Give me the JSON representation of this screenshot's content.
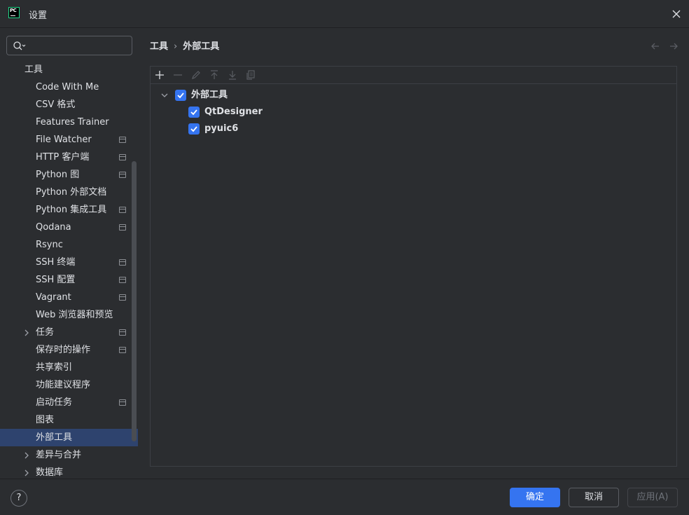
{
  "window": {
    "title": "设置"
  },
  "search": {
    "placeholder": ""
  },
  "sidebar": {
    "items": [
      {
        "label": "工具",
        "level": 0,
        "project": false
      },
      {
        "label": "Code With Me",
        "level": 1,
        "project": false
      },
      {
        "label": "CSV 格式",
        "level": 1,
        "project": false
      },
      {
        "label": "Features Trainer",
        "level": 1,
        "project": false
      },
      {
        "label": "File Watcher",
        "level": 1,
        "project": true
      },
      {
        "label": "HTTP 客户端",
        "level": 1,
        "project": true
      },
      {
        "label": "Python 图",
        "level": 1,
        "project": true
      },
      {
        "label": "Python 外部文档",
        "level": 1,
        "project": false
      },
      {
        "label": "Python 集成工具",
        "level": 1,
        "project": true
      },
      {
        "label": "Qodana",
        "level": 1,
        "project": true
      },
      {
        "label": "Rsync",
        "level": 1,
        "project": false
      },
      {
        "label": "SSH 终端",
        "level": 1,
        "project": true
      },
      {
        "label": "SSH 配置",
        "level": 1,
        "project": true
      },
      {
        "label": "Vagrant",
        "level": 1,
        "project": true
      },
      {
        "label": "Web 浏览器和预览",
        "level": 1,
        "project": false
      },
      {
        "label": "任务",
        "level": 1,
        "project": true,
        "expandable": true
      },
      {
        "label": "保存时的操作",
        "level": 1,
        "project": true
      },
      {
        "label": "共享索引",
        "level": 1,
        "project": false
      },
      {
        "label": "功能建议程序",
        "level": 1,
        "project": false
      },
      {
        "label": "启动任务",
        "level": 1,
        "project": true
      },
      {
        "label": "图表",
        "level": 1,
        "project": false
      },
      {
        "label": "外部工具",
        "level": 1,
        "project": false,
        "selected": true
      },
      {
        "label": "差异与合并",
        "level": 1,
        "project": false,
        "expandable": true
      },
      {
        "label": "数据库",
        "level": 1,
        "project": false,
        "expandable": true
      }
    ]
  },
  "breadcrumb": {
    "parent": "工具",
    "separator": "›",
    "current": "外部工具"
  },
  "tools": {
    "group": {
      "label": "外部工具",
      "checked": true,
      "expanded": true
    },
    "children": [
      {
        "label": "QtDesigner",
        "checked": true
      },
      {
        "label": "pyuic6",
        "checked": true
      }
    ]
  },
  "footer": {
    "help_label": "?",
    "ok_label": "确定",
    "cancel_label": "取消",
    "apply_label": "应用(A)"
  },
  "colors": {
    "accent": "#3574f0",
    "selection": "#2e436e",
    "background": "#2b2d30"
  }
}
